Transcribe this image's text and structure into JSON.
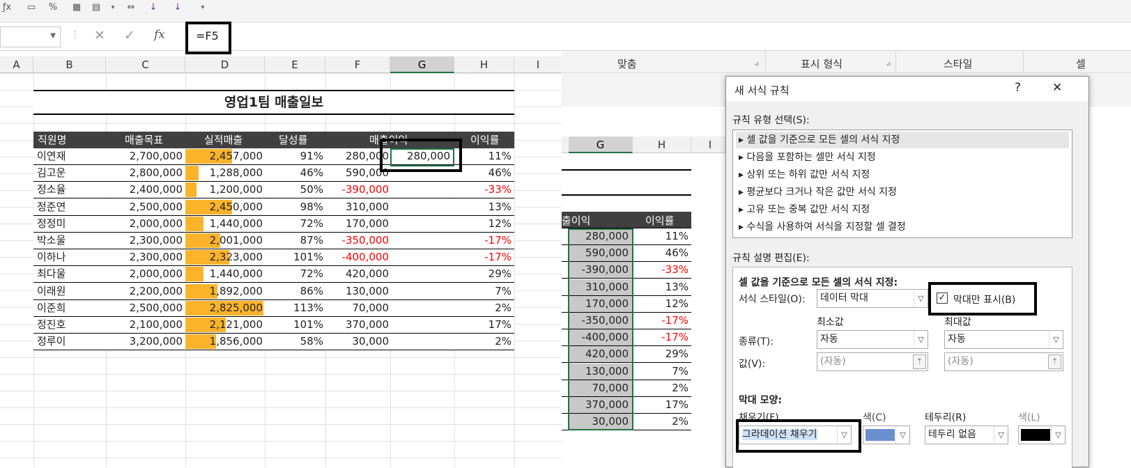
{
  "formula_bar": {
    "name_box": "",
    "cancel_glyph": "✕",
    "enter_glyph": "✓",
    "fx_glyph": "fx",
    "formula": "=F5"
  },
  "columns": [
    "A",
    "B",
    "C",
    "D",
    "E",
    "F",
    "G",
    "H",
    "I"
  ],
  "sheet": {
    "title": "영업1팀 매출일보",
    "headers": [
      "직원명",
      "매출목표",
      "실적매출",
      "달성률",
      "매출이익",
      "이익률"
    ],
    "rows": [
      {
        "name": "이연재",
        "target": "2,700,000",
        "actual": "2,457,000",
        "actual_ratio": 0.6,
        "rate": "91%",
        "profit": "280,000",
        "g": "280,000",
        "margin": "11%",
        "neg": false
      },
      {
        "name": "김고운",
        "target": "2,800,000",
        "actual": "1,288,000",
        "actual_ratio": 0.17,
        "rate": "46%",
        "profit": "590,000",
        "g": "",
        "margin": "46%",
        "neg": false
      },
      {
        "name": "정소율",
        "target": "2,400,000",
        "actual": "1,200,000",
        "actual_ratio": 0.14,
        "rate": "50%",
        "profit": "-390,000",
        "g": "",
        "margin": "-33%",
        "neg": true
      },
      {
        "name": "정준연",
        "target": "2,500,000",
        "actual": "2,450,000",
        "actual_ratio": 0.6,
        "rate": "98%",
        "profit": "310,000",
        "g": "",
        "margin": "13%",
        "neg": false
      },
      {
        "name": "정정미",
        "target": "2,000,000",
        "actual": "1,440,000",
        "actual_ratio": 0.23,
        "rate": "72%",
        "profit": "170,000",
        "g": "",
        "margin": "12%",
        "neg": false
      },
      {
        "name": "박소울",
        "target": "2,300,000",
        "actual": "2,001,000",
        "actual_ratio": 0.45,
        "rate": "87%",
        "profit": "-350,000",
        "g": "",
        "margin": "-17%",
        "neg": true
      },
      {
        "name": "이하나",
        "target": "2,300,000",
        "actual": "2,323,000",
        "actual_ratio": 0.56,
        "rate": "101%",
        "profit": "-400,000",
        "g": "",
        "margin": "-17%",
        "neg": true
      },
      {
        "name": "최다울",
        "target": "2,000,000",
        "actual": "1,440,000",
        "actual_ratio": 0.23,
        "rate": "72%",
        "profit": "420,000",
        "g": "",
        "margin": "29%",
        "neg": false
      },
      {
        "name": "이래원",
        "target": "2,200,000",
        "actual": "1,892,000",
        "actual_ratio": 0.41,
        "rate": "86%",
        "profit": "130,000",
        "g": "",
        "margin": "7%",
        "neg": false
      },
      {
        "name": "이준희",
        "target": "2,500,000",
        "actual": "2,825,000",
        "actual_ratio": 1.0,
        "rate": "113%",
        "profit": "70,000",
        "g": "",
        "margin": "2%",
        "neg": false
      },
      {
        "name": "정진호",
        "target": "2,100,000",
        "actual": "2,121,000",
        "actual_ratio": 0.52,
        "rate": "101%",
        "profit": "370,000",
        "g": "",
        "margin": "17%",
        "neg": false
      },
      {
        "name": "정루이",
        "target": "3,200,000",
        "actual": "1,856,000",
        "actual_ratio": 0.39,
        "rate": "58%",
        "profit": "30,000",
        "g": "",
        "margin": "2%",
        "neg": false
      }
    ]
  },
  "ribbon": {
    "align_label": "맞춤",
    "number_format_label": "표시 형식",
    "style_label": "스타일",
    "cell_label": "셀"
  },
  "right_sheet": {
    "col_g": "G",
    "col_h": "H",
    "col_i": "I",
    "header_profit": "출이익",
    "header_margin": "이익률",
    "rows": [
      {
        "g": "280,000",
        "h": "11%",
        "neg": false
      },
      {
        "g": "590,000",
        "h": "46%",
        "neg": false
      },
      {
        "g": "-390,000",
        "h": "-33%",
        "neg": true
      },
      {
        "g": "310,000",
        "h": "13%",
        "neg": false
      },
      {
        "g": "170,000",
        "h": "12%",
        "neg": false
      },
      {
        "g": "-350,000",
        "h": "-17%",
        "neg": true
      },
      {
        "g": "-400,000",
        "h": "-17%",
        "neg": true
      },
      {
        "g": "420,000",
        "h": "29%",
        "neg": false
      },
      {
        "g": "130,000",
        "h": "7%",
        "neg": false
      },
      {
        "g": "70,000",
        "h": "2%",
        "neg": false
      },
      {
        "g": "370,000",
        "h": "17%",
        "neg": false
      },
      {
        "g": "30,000",
        "h": "2%",
        "neg": false
      }
    ]
  },
  "dialog": {
    "title": "새 서식 규칙",
    "help": "?",
    "close": "✕",
    "rule_type_label": "규칙 유형 선택(S):",
    "rule_types": [
      "▸ 셀 값을 기준으로 모든 셀의 서식 지정",
      "▸ 다음을 포함하는 셀만 서식 지정",
      "▸ 상위 또는 하위 값만 서식 지정",
      "▸ 평균보다 크거나 작은 값만 서식 지정",
      "▸ 고유 또는 중복 값만 서식 지정",
      "▸ 수식을 사용하여 서식을 지정할 셀 결정"
    ],
    "edit_label": "규칙 설명 편집(E):",
    "desc_heading": "셀 값을 기준으로 모든 셀의 서식 지정:",
    "format_style_label": "서식 스타일(O):",
    "format_style_value": "데이터 막대",
    "bar_only_label": "막대만 표시(B)",
    "bar_only_checked": "✓",
    "min_label": "최소값",
    "max_label": "최대값",
    "type_label": "종류(T):",
    "type_min": "자동",
    "type_max": "자동",
    "value_label": "값(V):",
    "value_min": "(자동)",
    "value_max": "(자동)",
    "bar_appearance_label": "막대 모양:",
    "fill_label": "채우기(F)",
    "fill_value": "그라데이션 채우기",
    "fill_color_label": "색(C)",
    "border_label": "테두리(R)",
    "border_value": "테두리 없음",
    "border_color_label": "색(L)"
  },
  "colors": {
    "bar_orange": "#fbb32b",
    "header_dark": "#404040",
    "fill_color": "#6a8fce",
    "border_color": "#000000",
    "negative": "#ff0000",
    "selection_green": "#217346"
  }
}
